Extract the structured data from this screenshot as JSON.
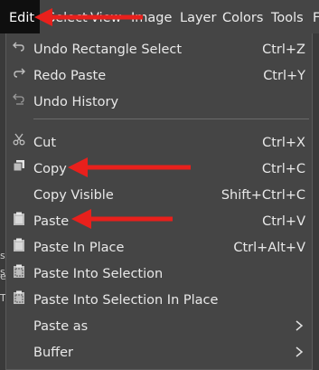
{
  "menubar": {
    "items": [
      {
        "label": "Edit"
      },
      {
        "label": "Select"
      },
      {
        "label": "View"
      },
      {
        "label": "Image"
      },
      {
        "label": "Layer"
      },
      {
        "label": "Colors"
      },
      {
        "label": "Tools"
      },
      {
        "label": "F"
      }
    ]
  },
  "edit_menu": {
    "items": [
      {
        "label": "Undo Rectangle Select",
        "shortcut": "Ctrl+Z",
        "icon": "undo-icon"
      },
      {
        "label": "Redo Paste",
        "shortcut": "Ctrl+Y",
        "icon": "redo-icon"
      },
      {
        "label": "Undo History",
        "shortcut": "",
        "icon": "undo-history-icon"
      },
      {
        "label": "Cut",
        "shortcut": "Ctrl+X",
        "icon": "scissors-icon"
      },
      {
        "label": "Copy",
        "shortcut": "Ctrl+C",
        "icon": "copy-icon"
      },
      {
        "label": "Copy Visible",
        "shortcut": "Shift+Ctrl+C",
        "icon": ""
      },
      {
        "label": "Paste",
        "shortcut": "Ctrl+V",
        "icon": "clipboard-icon"
      },
      {
        "label": "Paste In Place",
        "shortcut": "Ctrl+Alt+V",
        "icon": "clipboard-icon"
      },
      {
        "label": "Paste Into Selection",
        "shortcut": "",
        "icon": "paste-into-icon"
      },
      {
        "label": "Paste Into Selection In Place",
        "shortcut": "",
        "icon": "paste-into-icon"
      },
      {
        "label": "Paste as",
        "shortcut": "",
        "icon": "",
        "submenu": true
      },
      {
        "label": "Buffer",
        "shortcut": "",
        "icon": "",
        "submenu": true
      }
    ]
  },
  "background_strip": {
    "glyphs": [
      "s",
      "s",
      "e",
      "T"
    ]
  },
  "colors": {
    "annotation_arrow": "#e8201c",
    "menu_bg": "#454545",
    "active_menubar_bg": "#0f0f0f"
  }
}
